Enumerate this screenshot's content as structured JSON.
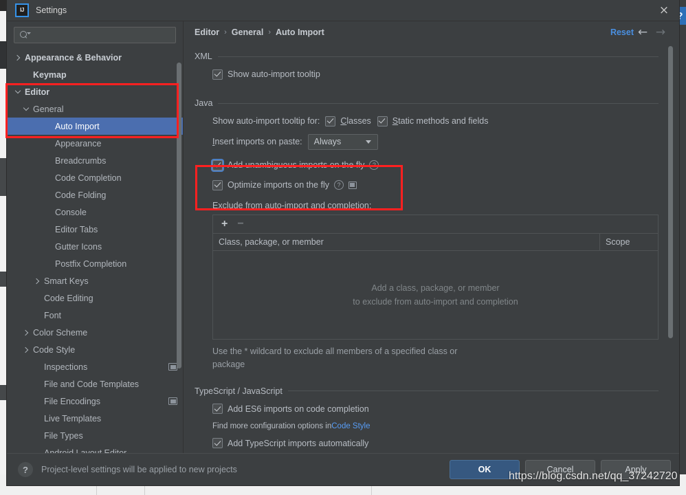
{
  "window": {
    "title": "Settings",
    "logo_text": "IJ",
    "close_icon": "×"
  },
  "search": {
    "value": "",
    "placeholder": ""
  },
  "sidebar": {
    "items": [
      {
        "label": "Appearance & Behavior",
        "indent": 0,
        "arrow": "right",
        "bold": true,
        "selected": false,
        "project_icon": false
      },
      {
        "label": "Keymap",
        "indent": 1,
        "arrow": "none",
        "bold": true,
        "selected": false,
        "project_icon": false
      },
      {
        "label": "Editor",
        "indent": 0,
        "arrow": "down",
        "bold": true,
        "selected": false,
        "project_icon": false
      },
      {
        "label": "General",
        "indent": 1,
        "arrow": "down",
        "bold": false,
        "selected": false,
        "project_icon": false
      },
      {
        "label": "Auto Import",
        "indent": 3,
        "arrow": "none",
        "bold": false,
        "selected": true,
        "project_icon": false
      },
      {
        "label": "Appearance",
        "indent": 3,
        "arrow": "none",
        "bold": false,
        "selected": false,
        "project_icon": false
      },
      {
        "label": "Breadcrumbs",
        "indent": 3,
        "arrow": "none",
        "bold": false,
        "selected": false,
        "project_icon": false
      },
      {
        "label": "Code Completion",
        "indent": 3,
        "arrow": "none",
        "bold": false,
        "selected": false,
        "project_icon": false
      },
      {
        "label": "Code Folding",
        "indent": 3,
        "arrow": "none",
        "bold": false,
        "selected": false,
        "project_icon": false
      },
      {
        "label": "Console",
        "indent": 3,
        "arrow": "none",
        "bold": false,
        "selected": false,
        "project_icon": false
      },
      {
        "label": "Editor Tabs",
        "indent": 3,
        "arrow": "none",
        "bold": false,
        "selected": false,
        "project_icon": false
      },
      {
        "label": "Gutter Icons",
        "indent": 3,
        "arrow": "none",
        "bold": false,
        "selected": false,
        "project_icon": false
      },
      {
        "label": "Postfix Completion",
        "indent": 3,
        "arrow": "none",
        "bold": false,
        "selected": false,
        "project_icon": false
      },
      {
        "label": "Smart Keys",
        "indent": 2,
        "arrow": "right",
        "bold": false,
        "selected": false,
        "project_icon": false
      },
      {
        "label": "Code Editing",
        "indent": 2,
        "arrow": "none",
        "bold": false,
        "selected": false,
        "project_icon": false
      },
      {
        "label": "Font",
        "indent": 2,
        "arrow": "none",
        "bold": false,
        "selected": false,
        "project_icon": false
      },
      {
        "label": "Color Scheme",
        "indent": 1,
        "arrow": "right",
        "bold": false,
        "selected": false,
        "project_icon": false
      },
      {
        "label": "Code Style",
        "indent": 1,
        "arrow": "right",
        "bold": false,
        "selected": false,
        "project_icon": false
      },
      {
        "label": "Inspections",
        "indent": 2,
        "arrow": "none",
        "bold": false,
        "selected": false,
        "project_icon": true
      },
      {
        "label": "File and Code Templates",
        "indent": 2,
        "arrow": "none",
        "bold": false,
        "selected": false,
        "project_icon": false
      },
      {
        "label": "File Encodings",
        "indent": 2,
        "arrow": "none",
        "bold": false,
        "selected": false,
        "project_icon": true
      },
      {
        "label": "Live Templates",
        "indent": 2,
        "arrow": "none",
        "bold": false,
        "selected": false,
        "project_icon": false
      },
      {
        "label": "File Types",
        "indent": 2,
        "arrow": "none",
        "bold": false,
        "selected": false,
        "project_icon": false
      },
      {
        "label": "Android Layout Editor",
        "indent": 2,
        "arrow": "none",
        "bold": false,
        "selected": false,
        "project_icon": false
      }
    ]
  },
  "breadcrumb": {
    "items": [
      "Editor",
      "General",
      "Auto Import"
    ],
    "separator": "›",
    "reset_label": "Reset",
    "back_icon": "←",
    "forward_icon": "→"
  },
  "main": {
    "xml": {
      "title": "XML",
      "show_tooltip": {
        "label": "Show auto-import tooltip",
        "checked": true
      }
    },
    "java": {
      "title": "Java",
      "tooltip_for_label": "Show auto-import tooltip for:",
      "tooltip_for_options": [
        {
          "label": "Classes",
          "checked": true,
          "mnemonic": "C"
        },
        {
          "label": "Static methods and fields",
          "checked": true,
          "mnemonic": "S"
        }
      ],
      "insert_imports_label": "Insert imports on paste:",
      "insert_imports_value": "Always",
      "add_unambiguous": {
        "label": "Add unambiguous imports on the fly",
        "checked": true,
        "focused": true,
        "help": true
      },
      "optimize_imports": {
        "label": "Optimize imports on the fly",
        "checked": true,
        "help": true,
        "project_icon": true
      },
      "exclude_label": "Exclude from auto-import and completion:",
      "table": {
        "add_icon": "+",
        "remove_icon": "−",
        "columns": [
          "Class, package, or member",
          "Scope"
        ],
        "empty_text_line1": "Add a class, package, or member",
        "empty_text_line2": "to exclude from auto-import and completion"
      },
      "hint": "Use the * wildcard to exclude all members of a specified class or package"
    },
    "typescript": {
      "title": "TypeScript / JavaScript",
      "add_es6": {
        "label": "Add ES6 imports on code completion",
        "checked": true
      },
      "config_hint_prefix": "Find more configuration options in ",
      "config_hint_link": "Code Style",
      "add_ts": {
        "label": "Add TypeScript imports automatically",
        "checked": true
      }
    }
  },
  "footer": {
    "help_icon": "?",
    "note": "Project-level settings will be applied to new projects",
    "buttons": [
      {
        "label": "OK",
        "primary": true
      },
      {
        "label": "Cancel",
        "primary": false
      },
      {
        "label": "Apply",
        "primary": false
      }
    ]
  },
  "background": {
    "help_badge": "?",
    "watermark": "https://blog.csdn.net/qq_37242720"
  },
  "colors": {
    "accent_selection": "#4b6eaf",
    "link": "#589df6",
    "reset_link": "#4a8fe0",
    "primary_button": "#365880",
    "annotation_red": "#ff2020",
    "panel_bg": "#3c3f41"
  }
}
